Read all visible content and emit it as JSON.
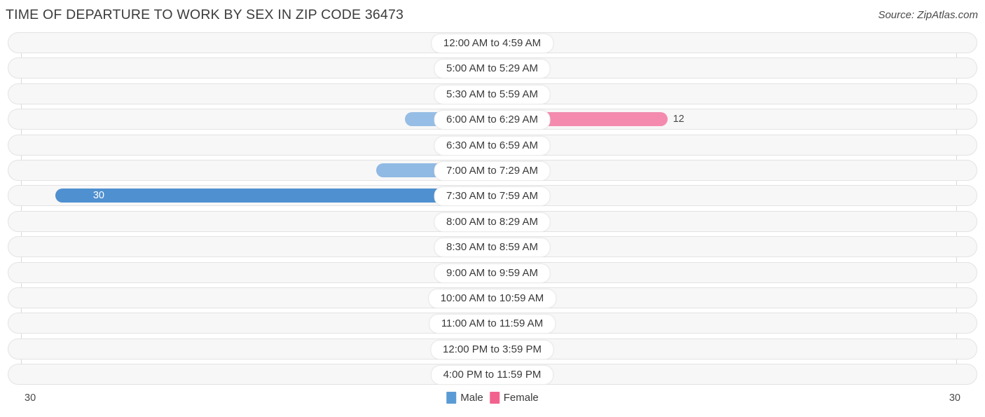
{
  "header": {
    "title": "TIME OF DEPARTURE TO WORK BY SEX IN ZIP CODE 36473",
    "source": "Source: ZipAtlas.com"
  },
  "legend": {
    "male_label": "Male",
    "female_label": "Female",
    "male_color": "#5b9bd5",
    "female_color": "#f2628f"
  },
  "axis": {
    "left_max": "30",
    "right_max": "30",
    "max_value": 30
  },
  "colors": {
    "male_min": "#a8c8ea",
    "male_max": "#4f90d0",
    "female_min": "#f7b0c8",
    "female_max": "#f0548a",
    "track_bg": "#f7f7f7",
    "track_border": "#e3e3e3"
  },
  "chart_data": {
    "type": "bar",
    "title": "TIME OF DEPARTURE TO WORK BY SEX IN ZIP CODE 36473",
    "xlabel": "",
    "ylabel": "",
    "orientation": "horizontal-diverging",
    "xlim": [
      30,
      30
    ],
    "grid": false,
    "legend_position": "bottom-center",
    "categories": [
      "12:00 AM to 4:59 AM",
      "5:00 AM to 5:29 AM",
      "5:30 AM to 5:59 AM",
      "6:00 AM to 6:29 AM",
      "6:30 AM to 6:59 AM",
      "7:00 AM to 7:29 AM",
      "7:30 AM to 7:59 AM",
      "8:00 AM to 8:29 AM",
      "8:30 AM to 8:59 AM",
      "9:00 AM to 9:59 AM",
      "10:00 AM to 10:59 AM",
      "11:00 AM to 11:59 AM",
      "12:00 PM to 3:59 PM",
      "4:00 PM to 11:59 PM"
    ],
    "series": [
      {
        "name": "Male",
        "side": "left",
        "values": [
          0,
          0,
          0,
          6,
          0,
          8,
          30,
          0,
          0,
          0,
          0,
          0,
          0,
          0
        ]
      },
      {
        "name": "Female",
        "side": "right",
        "values": [
          0,
          0,
          0,
          12,
          0,
          0,
          0,
          0,
          0,
          0,
          0,
          0,
          0,
          0
        ]
      }
    ]
  },
  "rows": [
    {
      "label": "12:00 AM to 4:59 AM",
      "male": 0,
      "male_text": "0",
      "female": 0,
      "female_text": "0"
    },
    {
      "label": "5:00 AM to 5:29 AM",
      "male": 0,
      "male_text": "0",
      "female": 0,
      "female_text": "0"
    },
    {
      "label": "5:30 AM to 5:59 AM",
      "male": 0,
      "male_text": "0",
      "female": 0,
      "female_text": "0"
    },
    {
      "label": "6:00 AM to 6:29 AM",
      "male": 6,
      "male_text": "6",
      "female": 12,
      "female_text": "12"
    },
    {
      "label": "6:30 AM to 6:59 AM",
      "male": 0,
      "male_text": "0",
      "female": 0,
      "female_text": "0"
    },
    {
      "label": "7:00 AM to 7:29 AM",
      "male": 8,
      "male_text": "8",
      "female": 0,
      "female_text": "0"
    },
    {
      "label": "7:30 AM to 7:59 AM",
      "male": 30,
      "male_text": "30",
      "female": 0,
      "female_text": "0"
    },
    {
      "label": "8:00 AM to 8:29 AM",
      "male": 0,
      "male_text": "0",
      "female": 0,
      "female_text": "0"
    },
    {
      "label": "8:30 AM to 8:59 AM",
      "male": 0,
      "male_text": "0",
      "female": 0,
      "female_text": "0"
    },
    {
      "label": "9:00 AM to 9:59 AM",
      "male": 0,
      "male_text": "0",
      "female": 0,
      "female_text": "0"
    },
    {
      "label": "10:00 AM to 10:59 AM",
      "male": 0,
      "male_text": "0",
      "female": 0,
      "female_text": "0"
    },
    {
      "label": "11:00 AM to 11:59 AM",
      "male": 0,
      "male_text": "0",
      "female": 0,
      "female_text": "0"
    },
    {
      "label": "12:00 PM to 3:59 PM",
      "male": 0,
      "male_text": "0",
      "female": 0,
      "female_text": "0"
    },
    {
      "label": "4:00 PM to 11:59 PM",
      "male": 0,
      "male_text": "0",
      "female": 0,
      "female_text": "0"
    }
  ]
}
